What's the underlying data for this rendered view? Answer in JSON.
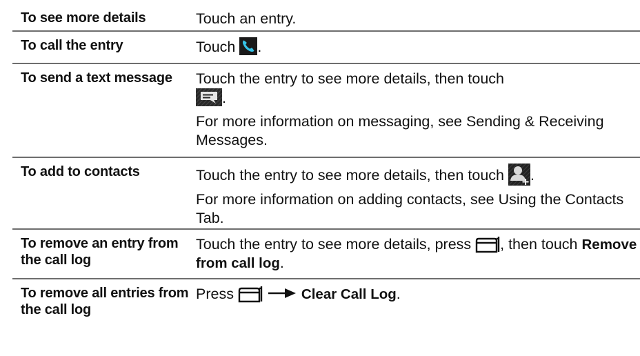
{
  "rows": [
    {
      "label": "To see more details",
      "desc_text": "Touch an entry."
    },
    {
      "label": "To call the entry",
      "desc_before": "Touch",
      "desc_after": ".",
      "icon": "phone-icon"
    },
    {
      "label": "To send a text message",
      "desc_before": "Touch the entry to see more details, then touch",
      "desc_after": ".",
      "icon": "message-icon",
      "note": "For more information on messaging, see Sending & Receiving Messages."
    },
    {
      "label": "To add to contacts",
      "desc_before": "Touch the entry to see more details, then touch",
      "desc_after": ".",
      "icon": "add-contact-icon",
      "note": "For more information on adding contacts, see Using the Contacts Tab."
    },
    {
      "label": "To remove an entry from the call log",
      "desc_before": "Touch the entry to see more details, press",
      "desc_middle": ", then touch",
      "desc_bold": "Remove from call log",
      "desc_after": ".",
      "icon": "menu-icon"
    },
    {
      "label": "To remove all entries from the call log",
      "desc_before": "Press",
      "desc_bold": "Clear Call Log",
      "desc_after": ".",
      "icon": "menu-icon",
      "icon2": "arrow-right-icon"
    }
  ],
  "colors": {
    "divider": "#6e6e6e",
    "text": "#111111",
    "phone_icon_bg": "#1a1a1a",
    "phone_icon_fg": "#36c3e8"
  }
}
